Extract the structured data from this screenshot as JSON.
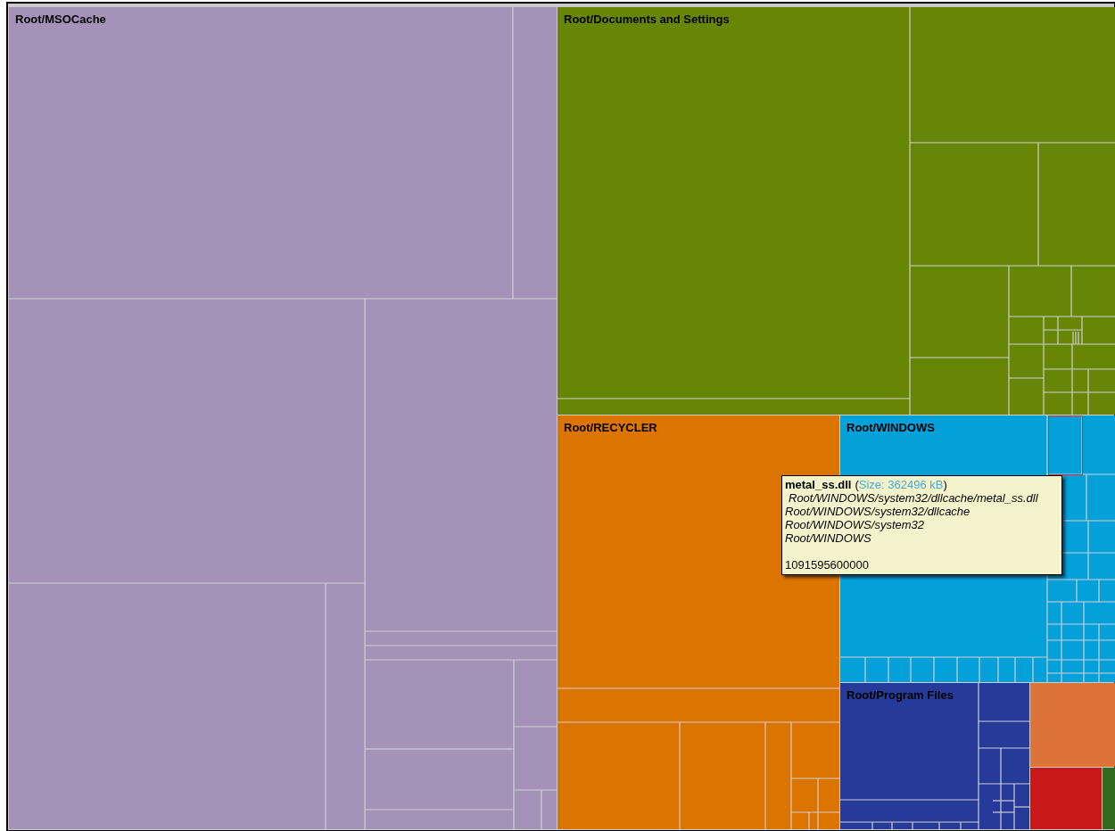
{
  "groups": [
    {
      "label": "Root/MSOCache",
      "color": "#a492b8"
    },
    {
      "label": "Root/Documents and Settings",
      "color": "#688606"
    },
    {
      "label": "Root/RECYCLER",
      "color": "#dc7400"
    },
    {
      "label": "Root/WINDOWS",
      "color": "#04a0da"
    },
    {
      "label": "Root/Program Files",
      "color": "#263a9a"
    },
    {
      "color": "#dc743a"
    },
    {
      "color": "#c81818"
    },
    {
      "color": "#346a1e"
    }
  ],
  "tooltip": {
    "name": "metal_ss.dll",
    "size_open": "(",
    "size": "Size: 362496 kB",
    "size_close": ")",
    "paths": [
      "Root/WINDOWS/system32/dllcache/metal_ss.dll",
      "Root/WINDOWS/system32/dllcache",
      "Root/WINDOWS/system32",
      "Root/WINDOWS"
    ],
    "value": "1091595600000"
  }
}
